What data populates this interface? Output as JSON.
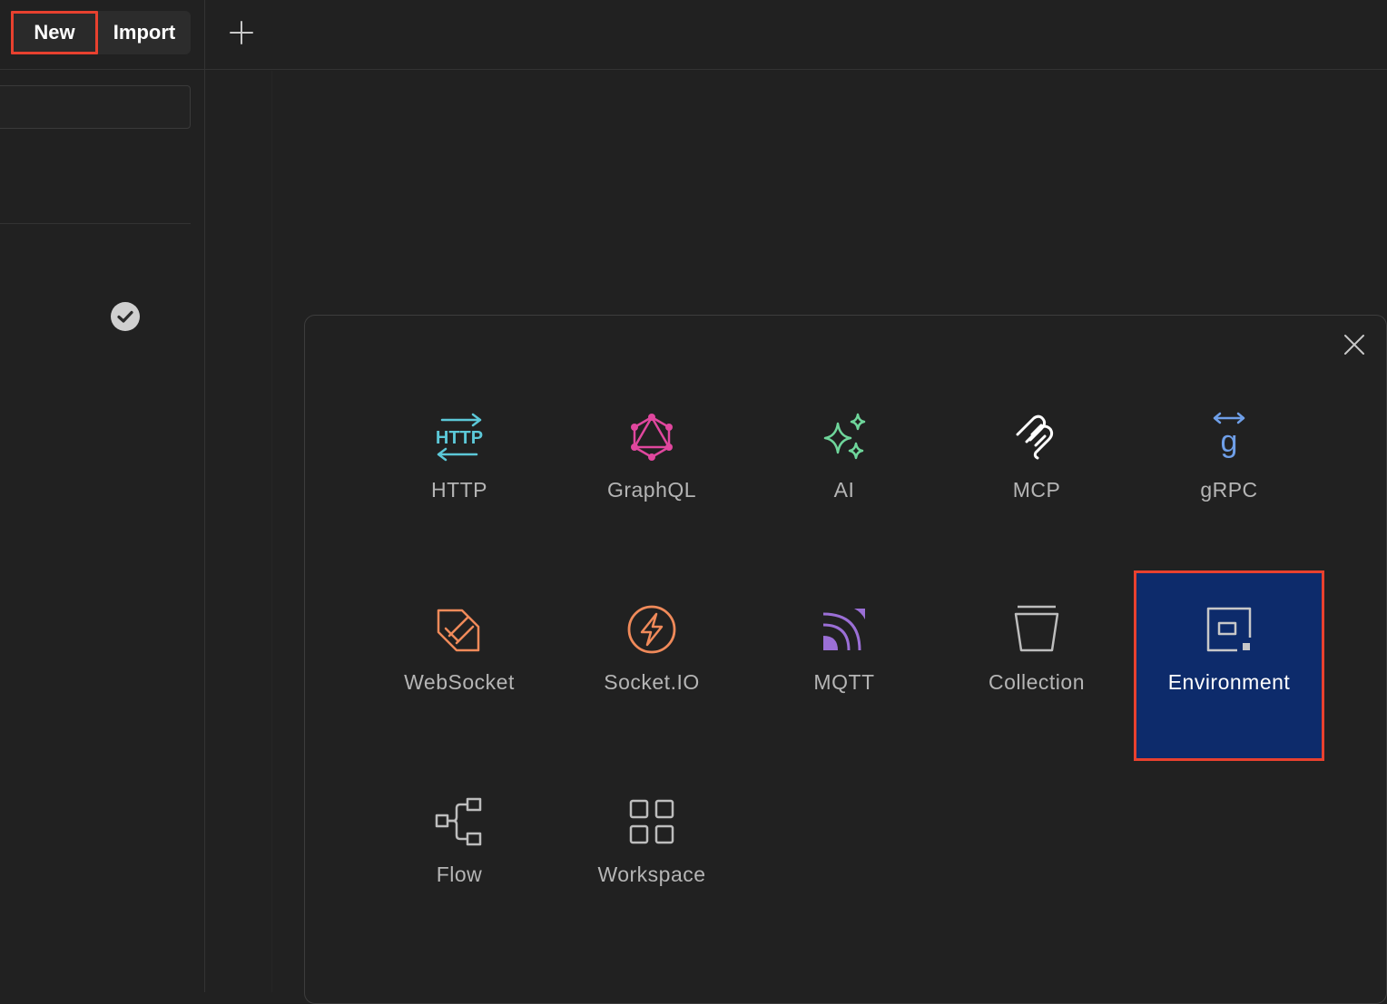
{
  "toolbar": {
    "new_label": "New",
    "import_label": "Import"
  },
  "modal": {
    "items": [
      {
        "label": "HTTP",
        "icon": "http-icon",
        "color": "#5cc8d8"
      },
      {
        "label": "GraphQL",
        "icon": "graphql-icon",
        "color": "#e0479e"
      },
      {
        "label": "AI",
        "icon": "ai-sparkle-icon",
        "color": "#6fd69b"
      },
      {
        "label": "MCP",
        "icon": "mcp-icon",
        "color": "#ffffff"
      },
      {
        "label": "gRPC",
        "icon": "grpc-icon",
        "color": "#6f9fe8"
      },
      {
        "label": "WebSocket",
        "icon": "websocket-icon",
        "color": "#f08a5a"
      },
      {
        "label": "Socket.IO",
        "icon": "socketio-icon",
        "color": "#f08a5a"
      },
      {
        "label": "MQTT",
        "icon": "mqtt-icon",
        "color": "#9b6fd6"
      },
      {
        "label": "Collection",
        "icon": "collection-icon",
        "color": "#bdbdbd"
      },
      {
        "label": "Environment",
        "icon": "environment-icon",
        "color": "#c8c8c8"
      },
      {
        "label": "Flow",
        "icon": "flow-icon",
        "color": "#bdbdbd"
      },
      {
        "label": "Workspace",
        "icon": "workspace-icon",
        "color": "#bdbdbd"
      }
    ],
    "selected_item": "Environment"
  },
  "colors": {
    "background": "#212121",
    "highlight_border": "#e8412f",
    "selected_tile": "#0d2b6b"
  }
}
